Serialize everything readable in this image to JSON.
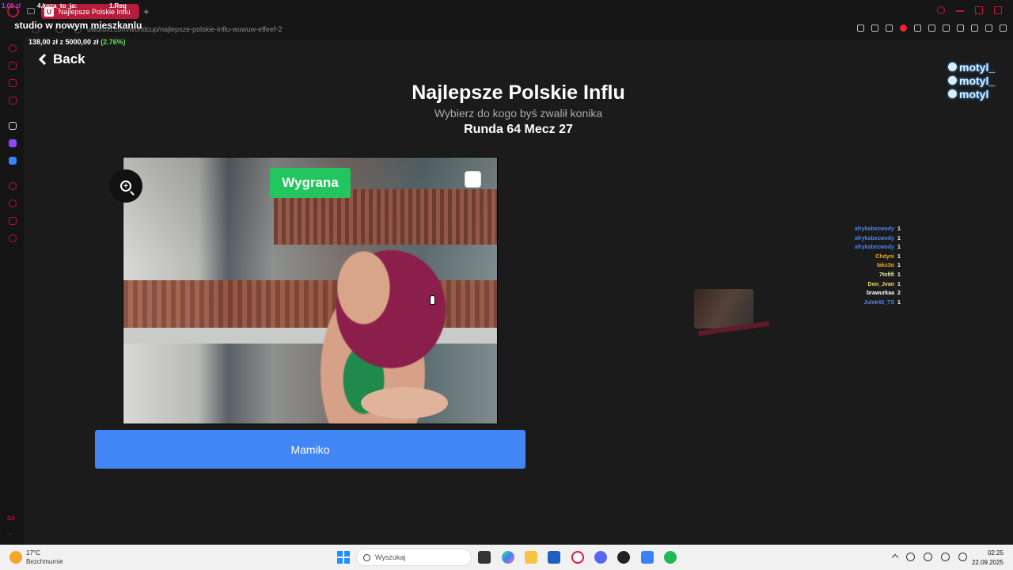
{
  "browser": {
    "tab_title": "Najlepsze Polskie Influ",
    "tab_favicon": "U",
    "url": "uwufufu.com/worldcup/najlepsze-polskie-influ-wuwuw-effeef-2"
  },
  "stream_overlay": {
    "top_left_a": "1,00 zł",
    "top_left_b": "4.koza_to_ja:",
    "top_left_c": "1.Req",
    "title": "studio w nowym mieszkanlu",
    "goal_text": "138,00 zł z 5000,00 zł",
    "goal_pct": "(2.76%)"
  },
  "page": {
    "back_label": "Back",
    "title": "Najlepsze Polskie Influ",
    "subtitle": "Wybierz do kogo byś zwalił konika",
    "round": "Runda 64 Mecz 27",
    "badge": "Wygrana",
    "choice_label": "Mamiko"
  },
  "socials": {
    "handles": [
      "motyl_",
      "motyl_",
      "motyl"
    ],
    "icons": [
      "instagram-icon",
      "discord-icon",
      "youtube-icon"
    ]
  },
  "chat": [
    {
      "name": "afrykabezwody",
      "count": "1",
      "color": "#4a86e8"
    },
    {
      "name": "afrykabezwody",
      "count": "1",
      "color": "#4a86e8"
    },
    {
      "name": "afrykabezwody",
      "count": "1",
      "color": "#4a86e8"
    },
    {
      "name": "Chdyni",
      "count": "1",
      "color": "#f5a623"
    },
    {
      "name": "taks3o",
      "count": "1",
      "color": "#f5a623"
    },
    {
      "name": "7tofifi",
      "count": "1",
      "color": "#e8e8a0"
    },
    {
      "name": "Don_Jvan",
      "count": "1",
      "color": "#f5d76e"
    },
    {
      "name": "brawurkaa",
      "count": "2",
      "color": "#ffffff"
    },
    {
      "name": "Julek43_TS",
      "count": "1",
      "color": "#4a86e8"
    }
  ],
  "sidebar": {
    "bottom_label": "GX",
    "more_label": "..."
  },
  "taskbar": {
    "temp": "17°C",
    "weather": "Bezchmurnie",
    "search_placeholder": "Wyszukaj",
    "time": "02:25",
    "date": "22.09.2025"
  },
  "colors": {
    "accent_red": "#c4122f",
    "button_blue": "#4285f4",
    "badge_green": "#22c55e"
  }
}
